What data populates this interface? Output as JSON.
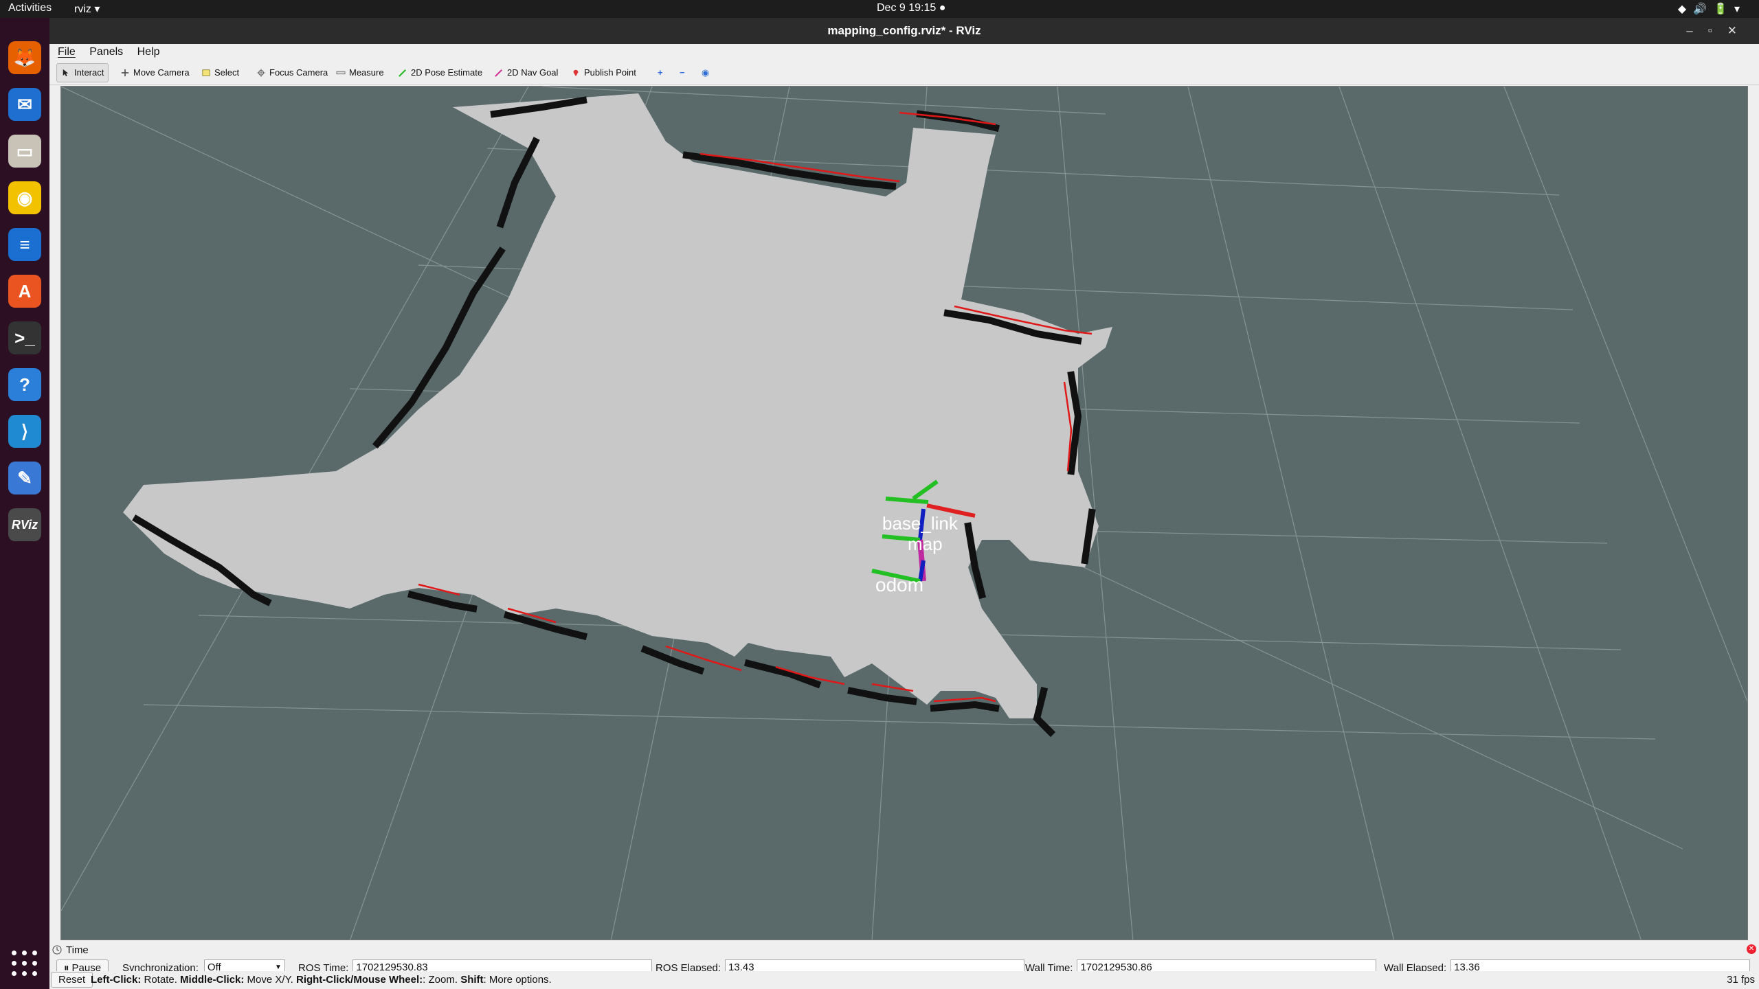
{
  "topbar": {
    "activities": "Activities",
    "app_menu": "rviz ▾",
    "clock": "Dec 9  19:15  ●",
    "tray": "◆🔊🔋▾"
  },
  "dock": {
    "apps": [
      {
        "name": "firefox-icon",
        "glyph": "🦊",
        "color": "#e66000"
      },
      {
        "name": "thunderbird-icon",
        "glyph": "✉",
        "color": "#1f6fd0"
      },
      {
        "name": "files-icon",
        "glyph": "▭",
        "color": "#c9c2b7"
      },
      {
        "name": "rhythmbox-icon",
        "glyph": "◉",
        "color": "#f2c200"
      },
      {
        "name": "writer-icon",
        "glyph": "≡",
        "color": "#1a6fd1"
      },
      {
        "name": "software-icon",
        "glyph": "A",
        "color": "#e95420"
      },
      {
        "name": "terminal-icon",
        "glyph": ">_",
        "color": "#333333"
      },
      {
        "name": "help-icon",
        "glyph": "?",
        "color": "#2b7fd8"
      },
      {
        "name": "vscode-icon",
        "glyph": "⟩",
        "color": "#1f8ad2"
      },
      {
        "name": "text-editor-icon",
        "glyph": "✎",
        "color": "#3a78d6"
      },
      {
        "name": "rviz-icon",
        "glyph": "RViz",
        "color": "#4a4a4a"
      }
    ]
  },
  "window": {
    "title": "mapping_config.rviz* - RViz",
    "controls": "–▫✕"
  },
  "menu": {
    "file": "File",
    "panels": "Panels",
    "help": "Help"
  },
  "toolbar": {
    "interact": "Interact",
    "move_camera": "Move Camera",
    "select": "Select",
    "focus_camera": "Focus Camera",
    "measure": "Measure",
    "pose_estimate": "2D Pose Estimate",
    "nav_goal": "2D Nav Goal",
    "publish_point": "Publish Point",
    "add": "+",
    "remove": "−",
    "camera_options": "◉"
  },
  "viewport": {
    "frames": {
      "base_link": "base_link",
      "map": "map",
      "odom": "odom"
    }
  },
  "time_panel": {
    "title": "Time",
    "pause": "Pause",
    "sync_label": "Synchronization:",
    "sync_value": "Off",
    "ros_time_label": "ROS Time:",
    "ros_time": "1702129530.83",
    "ros_elapsed_label": "ROS Elapsed:",
    "ros_elapsed": "13.43",
    "wall_time_label": "Wall Time:",
    "wall_time": "1702129530.86",
    "wall_elapsed_label": "Wall Elapsed:",
    "wall_elapsed": "13.36"
  },
  "status": {
    "reset": "Reset",
    "left_click": "Left-Click:",
    "left_click_desc": " Rotate. ",
    "middle_click": "Middle-Click:",
    "middle_click_desc": " Move X/Y. ",
    "right_click": "Right-Click/Mouse Wheel:",
    "right_click_desc": ": Zoom. ",
    "shift": "Shift",
    "shift_desc": ": More options.",
    "fps": "31 fps"
  }
}
